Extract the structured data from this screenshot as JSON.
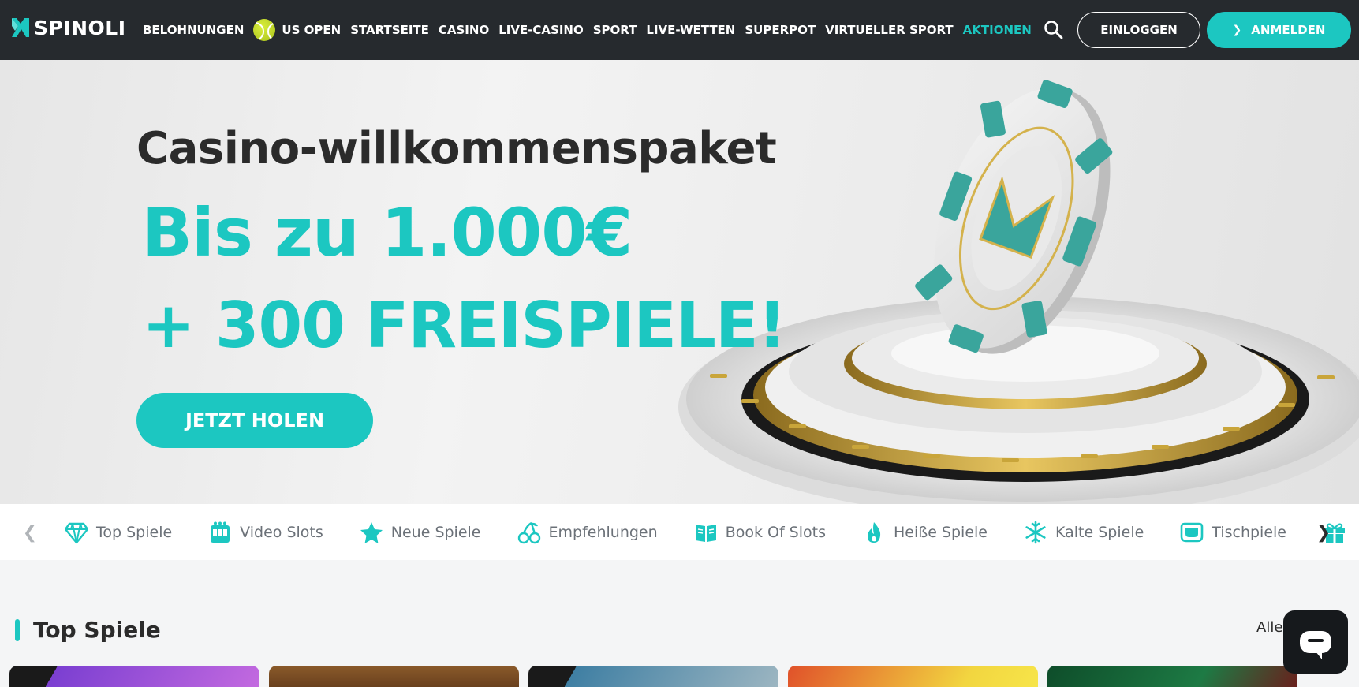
{
  "brand": {
    "name": "SPINOLI",
    "accent": "#1cc7c1",
    "dark": "#262a2e"
  },
  "nav": {
    "items": [
      {
        "label": "BELOHNUNGEN",
        "active": false,
        "icon": ""
      },
      {
        "label": "US OPEN",
        "active": false,
        "icon": "tennis-ball-icon"
      },
      {
        "label": "STARTSEITE",
        "active": false,
        "icon": ""
      },
      {
        "label": "CASINO",
        "active": false,
        "icon": ""
      },
      {
        "label": "LIVE-CASINO",
        "active": false,
        "icon": ""
      },
      {
        "label": "SPORT",
        "active": false,
        "icon": ""
      },
      {
        "label": "LIVE-WETTEN",
        "active": false,
        "icon": ""
      },
      {
        "label": "SUPERPOT",
        "active": false,
        "icon": ""
      },
      {
        "label": "VIRTUELLER SPORT",
        "active": false,
        "icon": ""
      },
      {
        "label": "AKTIONEN",
        "active": true,
        "icon": ""
      }
    ],
    "search_icon": "search-icon",
    "login_label": "EINLOGGEN",
    "register_label": "ANMELDEN"
  },
  "hero": {
    "title": "Casino-willkommenspaket",
    "amount": "Bis zu 1.000€",
    "spins": "+ 300 FREISPIELE!",
    "cta_label": "JETZT HOLEN"
  },
  "categories": [
    {
      "label": "Top Spiele",
      "icon": "diamond-icon"
    },
    {
      "label": "Video Slots",
      "icon": "slot-machine-icon"
    },
    {
      "label": "Neue Spiele",
      "icon": "star-icon"
    },
    {
      "label": "Empfehlungen",
      "icon": "cherry-icon"
    },
    {
      "label": "Book Of Slots",
      "icon": "book-icon"
    },
    {
      "label": "Heiße Spiele",
      "icon": "flame-icon"
    },
    {
      "label": "Kalte Spiele",
      "icon": "snowflake-icon"
    },
    {
      "label": "Tischpiele",
      "icon": "table-icon"
    },
    {
      "label": "",
      "icon": "gift-icon"
    }
  ],
  "section": {
    "title": "Top Spiele",
    "all_link": "Alle"
  },
  "games": [
    {
      "color": "#6a3fb5"
    },
    {
      "color": "#7a4a22"
    },
    {
      "color": "#2b5f7d"
    },
    {
      "color": "#d94a2a"
    },
    {
      "color": "#1d6a3a"
    }
  ]
}
